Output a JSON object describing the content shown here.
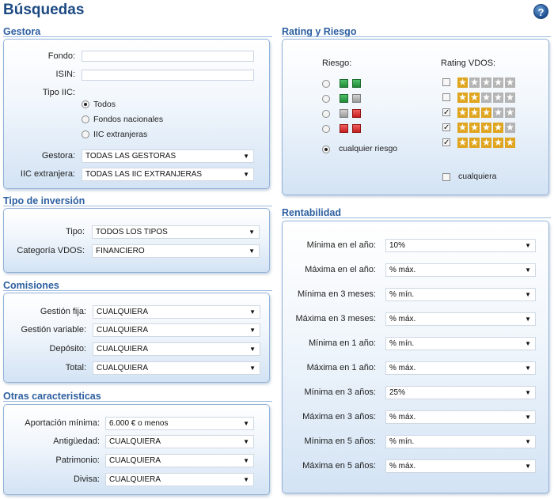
{
  "page": {
    "title": "Búsquedas",
    "help": "?"
  },
  "gestora": {
    "title": "Gestora",
    "fondo_label": "Fondo:",
    "isin_label": "ISIN:",
    "tipo_label": "Tipo IIC:",
    "tipo_options": [
      "Todos",
      "Fondos nacionales",
      "IIC extranjeras"
    ],
    "tipo_selected": 0,
    "gestora_label": "Gestora:",
    "gestora_value": "TODAS LAS GESTORAS",
    "extranjera_label": "IIC extranjera:",
    "extranjera_value": "TODAS LAS IIC EXTRANJERAS"
  },
  "tipo_inversion": {
    "title": "Tipo de inversión",
    "tipo_label": "Tipo:",
    "tipo_value": "TODOS LOS TIPOS",
    "categoria_label": "Categoría VDOS:",
    "categoria_value": "FINANCIERO"
  },
  "comisiones": {
    "title": "Comisiones",
    "rows": [
      {
        "label": "Gestión fija:",
        "value": "CUALQUIERA"
      },
      {
        "label": "Gestión variable:",
        "value": "CUALQUIERA"
      },
      {
        "label": "Depósito:",
        "value": "CUALQUIERA"
      },
      {
        "label": "Total:",
        "value": "CUALQUIERA"
      }
    ]
  },
  "otras": {
    "title": "Otras caracteristicas",
    "rows": [
      {
        "label": "Aportación mínima:",
        "value": "6.000 € o menos"
      },
      {
        "label": "Antigüedad:",
        "value": "CUALQUIERA"
      },
      {
        "label": "Patrimonio:",
        "value": "CUALQUIERA"
      },
      {
        "label": "Divisa:",
        "value": "CUALQUIERA"
      }
    ]
  },
  "rating": {
    "title": "Rating y Riesgo",
    "riesgo_label": "Riesgo:",
    "riesgo_rows": [
      {
        "colors": [
          "green",
          "green"
        ],
        "selected": false
      },
      {
        "colors": [
          "green",
          "gray"
        ],
        "selected": false
      },
      {
        "colors": [
          "gray",
          "red"
        ],
        "selected": false
      },
      {
        "colors": [
          "red",
          "red"
        ],
        "selected": false
      }
    ],
    "riesgo_any_label": "cualquier riesgo",
    "riesgo_any_selected": true,
    "vdos_label": "Rating VDOS:",
    "vdos_rows": [
      {
        "stars": 1,
        "checked": false
      },
      {
        "stars": 2,
        "checked": false
      },
      {
        "stars": 3,
        "checked": true
      },
      {
        "stars": 4,
        "checked": true
      },
      {
        "stars": 5,
        "checked": true
      }
    ],
    "vdos_any_label": "cualquiera",
    "vdos_any_checked": false,
    "colors": {
      "gold": "#e0a51f",
      "gray": "#b4b4b4",
      "green": "#2aa64a",
      "red": "#d42a2a"
    }
  },
  "rentabilidad": {
    "title": "Rentabilidad",
    "rows": [
      {
        "label": "Mínima en el año:",
        "value": "10%"
      },
      {
        "label": "Máxima en el año:",
        "value": "% máx."
      },
      {
        "label": "Mínima en 3 meses:",
        "value": "% mín."
      },
      {
        "label": "Máxima en 3 meses:",
        "value": "% máx."
      },
      {
        "label": "Mínima en 1 año:",
        "value": "% mín."
      },
      {
        "label": "Máxima en 1 año:",
        "value": "% máx."
      },
      {
        "label": "Mínima en 3 años:",
        "value": "25%"
      },
      {
        "label": "Máxima en 3 años:",
        "value": "% máx."
      },
      {
        "label": "Mínima en 5 años:",
        "value": "% mín."
      },
      {
        "label": "Máxima en 5 años:",
        "value": "% máx."
      }
    ]
  },
  "icons": {
    "help": "help-icon",
    "dropdown": "chevron-down-icon",
    "star": "star-icon"
  }
}
